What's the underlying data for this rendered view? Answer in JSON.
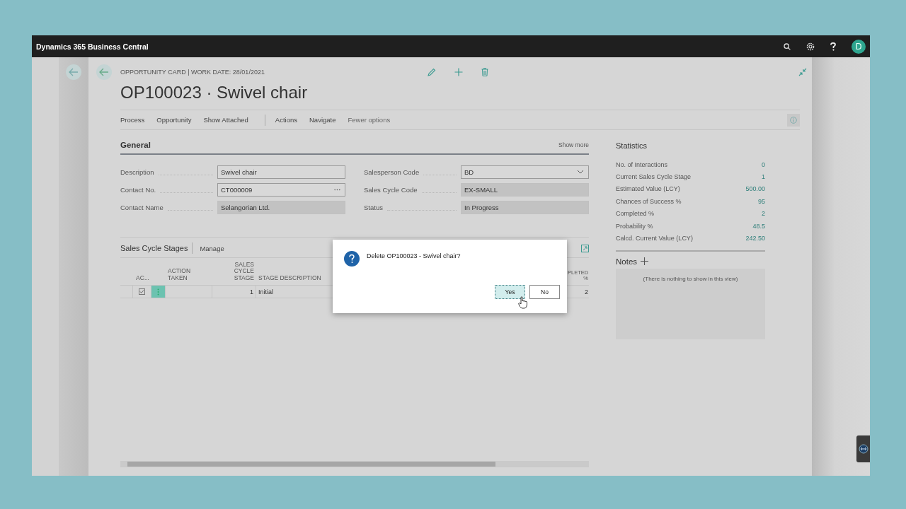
{
  "app": {
    "title": "Dynamics 365 Business Central",
    "avatar": "D"
  },
  "page": {
    "breadcrumb": "OPPORTUNITY CARD | WORK DATE: 28/01/2021",
    "title": "OP100023 · Swivel chair"
  },
  "action_bar": {
    "menus": [
      "Process",
      "Opportunity",
      "Show Attached"
    ],
    "more_menus": [
      "Actions",
      "Navigate"
    ],
    "options_toggle": "Fewer options"
  },
  "general": {
    "title": "General",
    "show_more": "Show more",
    "left_fields": [
      {
        "label": "Description",
        "value": "Swivel chair",
        "kind": "text"
      },
      {
        "label": "Contact No.",
        "value": "CT000009",
        "kind": "lookup"
      },
      {
        "label": "Contact Name",
        "value": "Selangorian Ltd.",
        "kind": "readonly"
      }
    ],
    "right_fields": [
      {
        "label": "Salesperson Code",
        "value": "BD",
        "kind": "dropdown"
      },
      {
        "label": "Sales Cycle Code",
        "value": "EX-SMALL",
        "kind": "readonly"
      },
      {
        "label": "Status",
        "value": "In Progress",
        "kind": "readonly"
      }
    ]
  },
  "sales_cycle_stages": {
    "title": "Sales Cycle Stages",
    "action": "Manage",
    "columns": [
      "AC...",
      "ACTION TAKEN",
      "SALES CYCLE STAGE",
      "STAGE DESCRIPTION",
      "PLETED %"
    ],
    "rows": [
      {
        "checked": true,
        "action_taken": "",
        "stage": "1",
        "description": "Initial",
        "completed": "2"
      }
    ]
  },
  "statistics": {
    "title": "Statistics",
    "rows": [
      {
        "label": "No. of Interactions",
        "value": "0"
      },
      {
        "label": "Current Sales Cycle Stage",
        "value": "1"
      },
      {
        "label": "Estimated Value (LCY)",
        "value": "500.00"
      },
      {
        "label": "Chances of Success %",
        "value": "95"
      },
      {
        "label": "Completed %",
        "value": "2"
      },
      {
        "label": "Probability %",
        "value": "48.5"
      },
      {
        "label": "Calcd. Current Value (LCY)",
        "value": "242.50"
      }
    ]
  },
  "notes": {
    "title": "Notes",
    "empty": "(There is nothing to show in this view)"
  },
  "dialog": {
    "message": "Delete OP100023 - Swivel chair?",
    "buttons": [
      {
        "label": "Yes",
        "focused": true
      },
      {
        "label": "No",
        "focused": false
      }
    ]
  }
}
